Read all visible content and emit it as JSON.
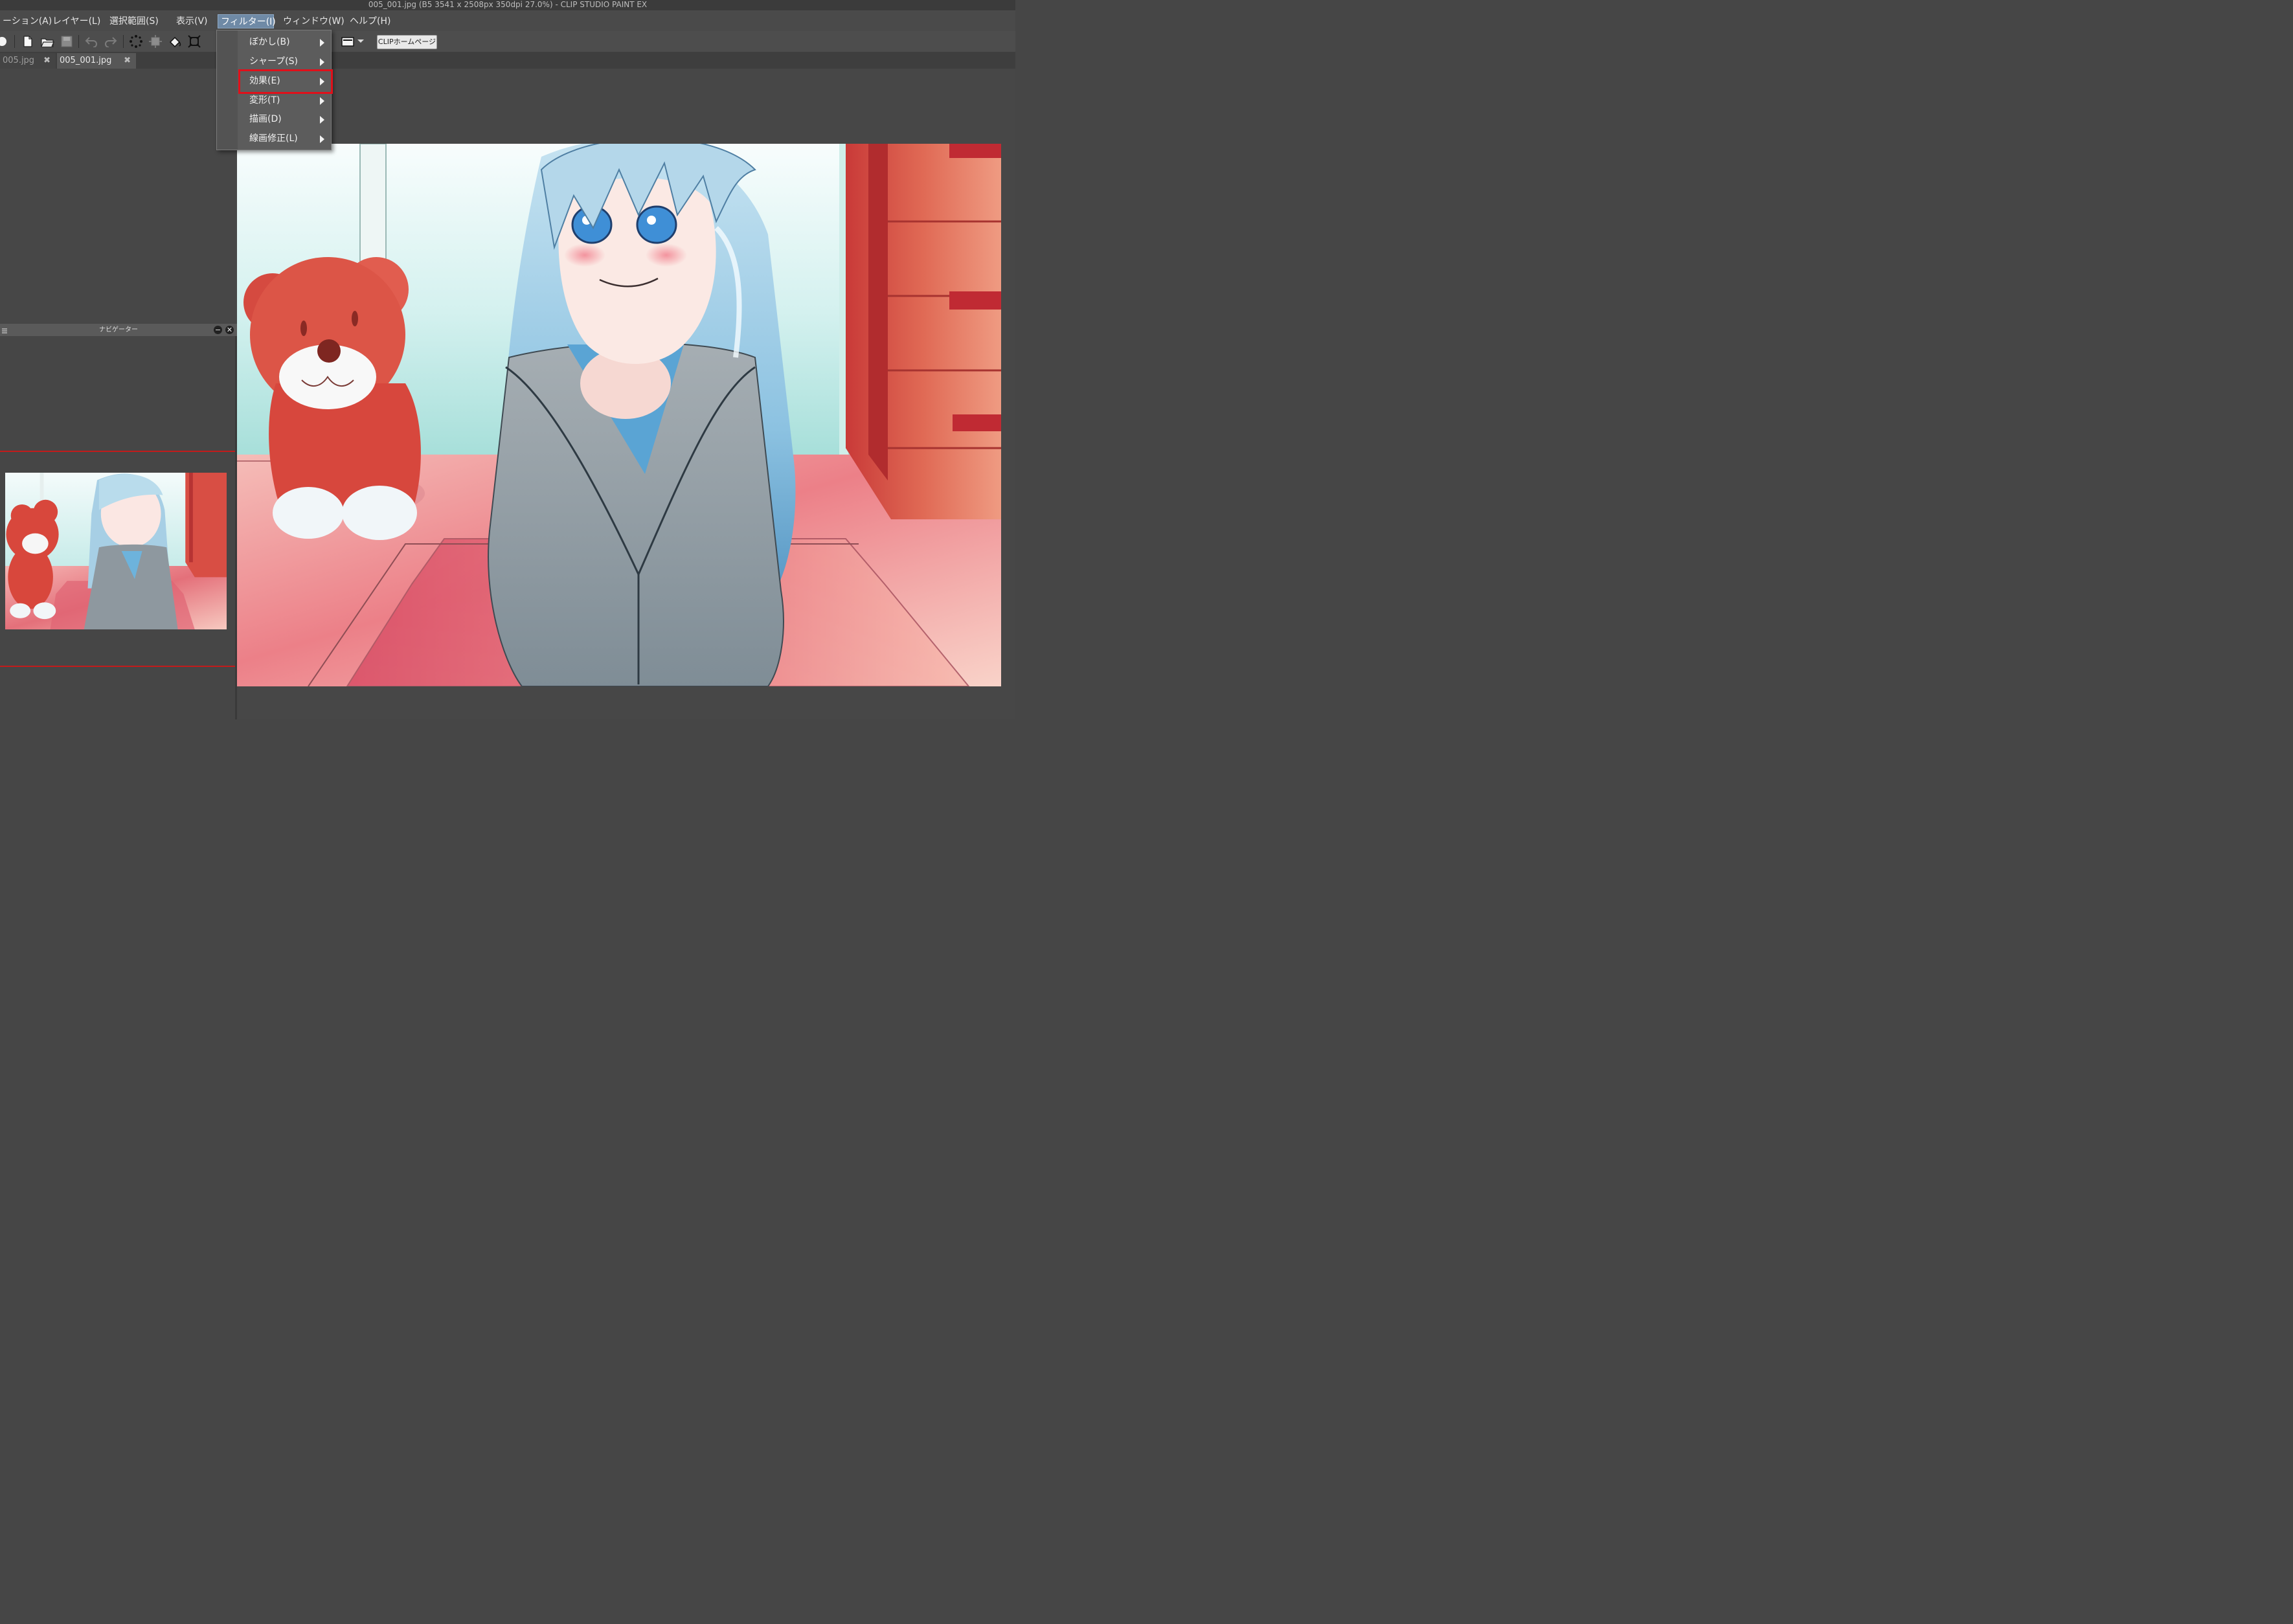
{
  "window": {
    "title": "005_001.jpg (B5 3541 x 2508px 350dpi 27.0%)  - CLIP STUDIO PAINT EX"
  },
  "menubar": {
    "items": [
      {
        "label": "ーション(A)"
      },
      {
        "label": "レイヤー(L)"
      },
      {
        "label": "選択範囲(S)"
      },
      {
        "label": "表示(V)"
      },
      {
        "label": "フィルター(I)",
        "active": true
      },
      {
        "label": "ウィンドウ(W)"
      },
      {
        "label": "ヘルプ(H)"
      }
    ]
  },
  "toolbar": {
    "icons": [
      "record-icon",
      "new-file-icon",
      "open-folder-icon",
      "save-icon",
      "undo-icon",
      "redo-icon",
      "selection-dots-icon",
      "transform-icon",
      "fill-bucket-icon",
      "crop-icon",
      "frame-icon"
    ],
    "home_button_label": "CLIPホームページ"
  },
  "tabs": [
    {
      "label": "005.jpg",
      "close": "✖",
      "active": false
    },
    {
      "label": "005_001.jpg",
      "close": "✖",
      "active": true
    }
  ],
  "filter_menu": {
    "items": [
      {
        "label": "ぼかし(B)",
        "submenu": true
      },
      {
        "label": "シャープ(S)",
        "submenu": true
      },
      {
        "label": "効果(E)",
        "submenu": true,
        "highlighted": true
      },
      {
        "label": "変形(T)",
        "submenu": true
      },
      {
        "label": "描画(D)",
        "submenu": true
      },
      {
        "label": "線画修正(L)",
        "submenu": true
      }
    ]
  },
  "navigator": {
    "title": "ナビゲーター",
    "minimize": "−",
    "close": "✕"
  },
  "colors": {
    "highlight_border": "#e0101a",
    "menu_active": "#6f8aa6",
    "guide_lines": "#c31b1b"
  }
}
